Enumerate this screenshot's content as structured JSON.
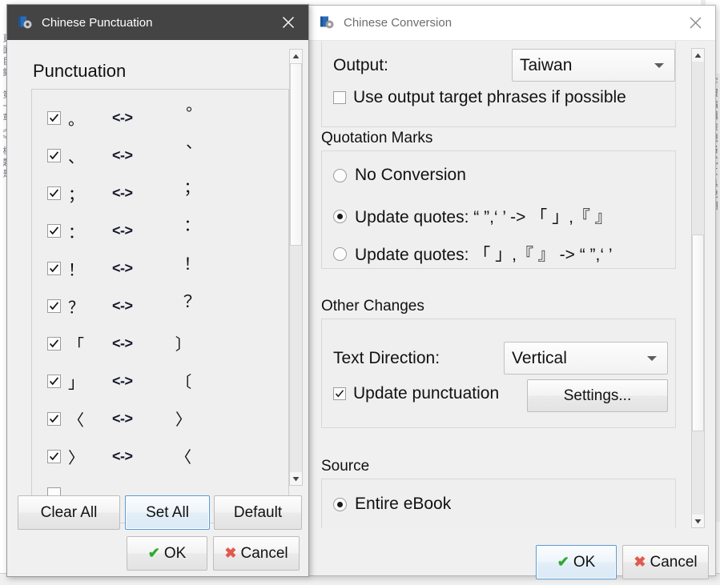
{
  "background": {
    "left_rail_text": "頁 面 目 錄 ： 第 一 章 《 》 標 題 是",
    "right_rail_text": "字 體 編 輯 檢 視 格 式 工 具 說 明"
  },
  "punctuation_dialog": {
    "title": "Chinese Punctuation",
    "icon": "book-gear-icon",
    "close_icon": "close-icon",
    "heading": "Punctuation",
    "arrow_label": "<->",
    "rows": [
      {
        "checked": true,
        "source": "。",
        "target": "︒",
        "target_style": "raise-sm"
      },
      {
        "checked": true,
        "source": "、",
        "target": "︑",
        "target_style": "raise-sm"
      },
      {
        "checked": true,
        "source": "；",
        "target": "︔",
        "target_style": "raise-sm"
      },
      {
        "checked": true,
        "source": "：",
        "target": "︓",
        "target_style": "raise-sm"
      },
      {
        "checked": true,
        "source": "！",
        "target": "︕",
        "target_style": "raise-sm"
      },
      {
        "checked": true,
        "source": "？",
        "target": "︖",
        "target_style": "raise-sm"
      },
      {
        "checked": true,
        "source": "「",
        "target": "︹",
        "target_style": "rot"
      },
      {
        "checked": true,
        "source": "」",
        "target": "︺",
        "target_style": "rot"
      },
      {
        "checked": true,
        "source": "〈",
        "target": "︿",
        "target_style": "rot"
      },
      {
        "checked": true,
        "source": "〉",
        "target": "﹀",
        "target_style": "rot"
      }
    ],
    "buttons": {
      "clear_all": "Clear All",
      "set_all": "Set All",
      "default": "Default",
      "ok": "OK",
      "cancel": "Cancel"
    },
    "scrollbar": {
      "up_icon": "scroll-up-arrow-icon",
      "down_icon": "scroll-down-arrow-icon"
    }
  },
  "conversion_dialog": {
    "title": "Chinese Conversion",
    "icon": "book-gear-icon",
    "close_icon": "close-icon",
    "output": {
      "label": "Output:",
      "value": "Taiwan",
      "dropdown_icon": "chevron-down-icon"
    },
    "use_target_phrases": {
      "label": "Use output target phrases if possible",
      "checked": false
    },
    "quotation_marks": {
      "group_label": "Quotation Marks",
      "options": [
        {
          "label": "No Conversion",
          "selected": false
        },
        {
          "label": "Update quotes: “ ”,‘ ’ -> 「 」,『 』",
          "selected": true
        },
        {
          "label": "Update quotes: 「 」,『 』 -> “ ”,‘ ’",
          "selected": false
        }
      ]
    },
    "other_changes": {
      "group_label": "Other Changes",
      "text_direction": {
        "label": "Text Direction:",
        "value": "Vertical",
        "dropdown_icon": "chevron-down-icon"
      },
      "update_punctuation": {
        "label": "Update punctuation",
        "checked": true
      },
      "settings_button": "Settings..."
    },
    "source": {
      "group_label": "Source",
      "options": [
        {
          "label": "Entire eBook",
          "selected": true
        }
      ]
    },
    "buttons": {
      "ok": "OK",
      "cancel": "Cancel"
    },
    "scrollbar": {
      "up_icon": "scroll-up-arrow-icon",
      "down_icon": "scroll-down-arrow-icon"
    }
  },
  "colors": {
    "active_titlebar": "#444444",
    "inactive_titlebar": "#ffffff",
    "dialog_face": "#f0f0f0",
    "focus_border": "#5a9ad4",
    "ok_check": "#2faa2f",
    "cancel_x": "#e05a4e",
    "accent_icon_blue": "#2a6bb5"
  }
}
